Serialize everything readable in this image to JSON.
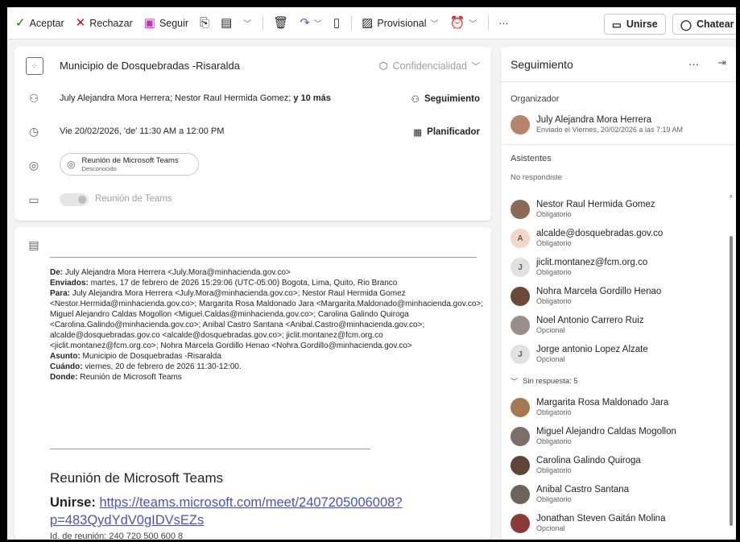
{
  "toolbar": {
    "accept": "Aceptar",
    "reject": "Rechazar",
    "follow": "Seguir",
    "status": "Provisional",
    "more": "···",
    "join": "Unirse",
    "chat": "Chatear"
  },
  "event": {
    "title": "Municipio de Dosquebradas -Risaralda",
    "sensitivity": "Confidencialidad",
    "attendees_text": "July Alejandra Mora Herrera;  Nestor Raul Hermida Gomez;",
    "attendees_more": "y 10 más",
    "tracking_btn": "Seguimiento",
    "datetime": "Vie 20/02/2026, 'de' 11:30 AM a 12:00 PM",
    "scheduler_btn": "Planificador",
    "location_name": "Reunión de Microsoft Teams",
    "location_status": "Desconocido",
    "teams_toggle_label": "Reunión de Teams"
  },
  "message": {
    "from_label": "De:",
    "from": " July Alejandra Mora Herrera <July.Mora@minhacienda.gov.co>",
    "sent_label": "Enviados:",
    "sent": " martes, 17 de febrero de 2026 15:29:06 (UTC-05:00) Bogota, Lima, Quito, Rio Branco",
    "to_label": "Para:",
    "to": " July Alejandra Mora Herrera <July.Mora@minhacienda.gov.co>; Nestor Raul Hermida Gomez <Nestor.Hermida@minhacienda.gov.co>; Margarita Rosa Maldonado Jara <Margarita.Maldonado@minhacienda.gov.co>; Miguel Alejandro Caldas Mogollon <Miguel.Caldas@minhacienda.gov.co>; Carolina Galindo Quiroga <Carolina.Galindo@minhacienda.gov.co>; Anibal Castro Santana <Anibal.Castro@minhacienda.gov.co>; alcalde@dosquebradas.gov.co <alcalde@dosquebradas.gov.co>; jiclit.montanez@fcm.org.co <jiclit.montanez@fcm.org.co>; Nohra Marcela Gordillo Henao <Nohra.Gordillo@minhacienda.gov.co>",
    "subject_label": "Asunto:",
    "subject": " Municipio de Dosquebradas -Risaralda",
    "when_label": "Cuándo:",
    "when": " viernes, 20 de febrero de 2026 11:30-12:00.",
    "where_label": "Donde:",
    "where": " Reunión de Microsoft Teams",
    "teams_heading": "Reunión de Microsoft Teams",
    "join_label": "Unirse:",
    "join_link": "https://teams.microsoft.com/meet/2407205006008?p=483QydYdV0gIDVsEZs",
    "meeting_id": "Id. de reunión: 240 720 500 600 8"
  },
  "panel": {
    "title": "Seguimiento",
    "more": "···",
    "organizer_label": "Organizador",
    "organizer_name": "July Alejandra Mora Herrera",
    "organizer_sent": "Enviado el Viernes, 20/02/2026 a las 7:19 AM",
    "attendees_label": "Asistentes",
    "not_responded": "No respondiste",
    "no_response_group": "Sin respuesta: 5",
    "attendees": [
      {
        "name": "Nestor Raul Hermida Gomez",
        "role": "Obligatorio",
        "initial": "",
        "color": "#8a6a55"
      },
      {
        "name": "alcalde@dosquebradas.gov.co",
        "role": "Obligatorio",
        "initial": "A",
        "color": "#f3d6c6"
      },
      {
        "name": "jiclit.montanez@fcm.org.co",
        "role": "Obligatorio",
        "initial": "J",
        "color": "#e1e1e1"
      },
      {
        "name": "Nohra Marcela Gordillo Henao",
        "role": "Obligatorio",
        "initial": "",
        "color": "#6b4a3a"
      },
      {
        "name": "Noel Antonio Carrero Ruiz",
        "role": "Opcional",
        "initial": "",
        "color": "#9a8f88"
      },
      {
        "name": "Jorge antonio Lopez Alzate",
        "role": "Opcional",
        "initial": "J",
        "color": "#e1e1e1"
      }
    ],
    "no_response": [
      {
        "name": "Margarita Rosa Maldonado Jara",
        "role": "Obligatorio",
        "color": "#a5784f"
      },
      {
        "name": "Miguel Alejandro Caldas Mogollon",
        "role": "Obligatorio",
        "color": "#7d6f66"
      },
      {
        "name": "Carolina Galindo Quiroga",
        "role": "Obligatorio",
        "color": "#5e4536"
      },
      {
        "name": "Anibal Castro Santana",
        "role": "Obligatorio",
        "color": "#6f6258"
      },
      {
        "name": "Jonathan Steven Gaitán Molina",
        "role": "Opcional",
        "color": "#8b3a3a"
      }
    ]
  }
}
